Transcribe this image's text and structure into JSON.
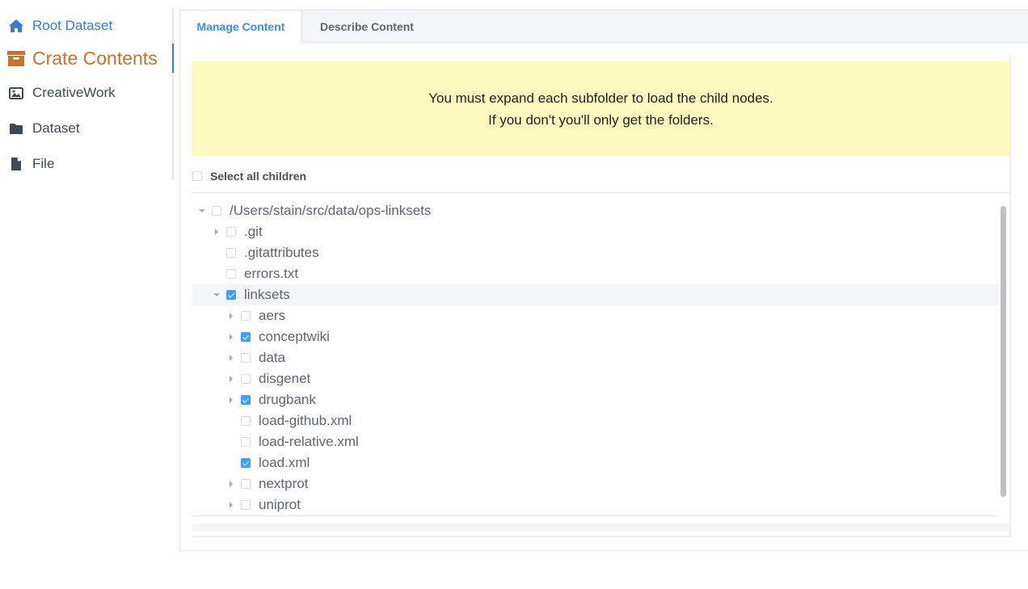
{
  "sidebar": {
    "items": [
      {
        "label": "Root Dataset",
        "icon": "home-icon"
      },
      {
        "label": "Crate Contents",
        "icon": "archive-icon"
      },
      {
        "label": "CreativeWork",
        "icon": "image-icon"
      },
      {
        "label": "Dataset",
        "icon": "folder-icon"
      },
      {
        "label": "File",
        "icon": "file-icon"
      }
    ],
    "active_color": "#c9722b",
    "link_color": "#3a7bc8"
  },
  "tabs": [
    {
      "label": "Manage Content",
      "active": true
    },
    {
      "label": "Describe Content",
      "active": false
    }
  ],
  "notice": {
    "line1": "You must expand each subfolder to load the child nodes.",
    "line2": "If you don't you'll only get the folders.",
    "background": "#fbf9bd"
  },
  "select_all": {
    "label": "Select all children",
    "checked": false
  },
  "tree": [
    {
      "label": "/Users/stain/src/data/ops-linksets",
      "expander": "down",
      "checked": false
    },
    {
      "label": ".git",
      "expander": "right",
      "checked": false
    },
    {
      "label": ".gitattributes",
      "expander": "none",
      "checked": false
    },
    {
      "label": "errors.txt",
      "expander": "none",
      "checked": false
    },
    {
      "label": "linksets",
      "expander": "down",
      "checked": true
    },
    {
      "label": "aers",
      "expander": "right",
      "checked": false
    },
    {
      "label": "conceptwiki",
      "expander": "right",
      "checked": true
    },
    {
      "label": "data",
      "expander": "right",
      "checked": false
    },
    {
      "label": "disgenet",
      "expander": "right",
      "checked": false
    },
    {
      "label": "drugbank",
      "expander": "right",
      "checked": true
    },
    {
      "label": "load-github.xml",
      "expander": "none",
      "checked": false
    },
    {
      "label": "load-relative.xml",
      "expander": "none",
      "checked": false
    },
    {
      "label": "load.xml",
      "expander": "none",
      "checked": true
    },
    {
      "label": "nextprot",
      "expander": "right",
      "checked": false
    },
    {
      "label": "uniprot",
      "expander": "right",
      "checked": false
    }
  ],
  "checkbox_color": "#409eff"
}
